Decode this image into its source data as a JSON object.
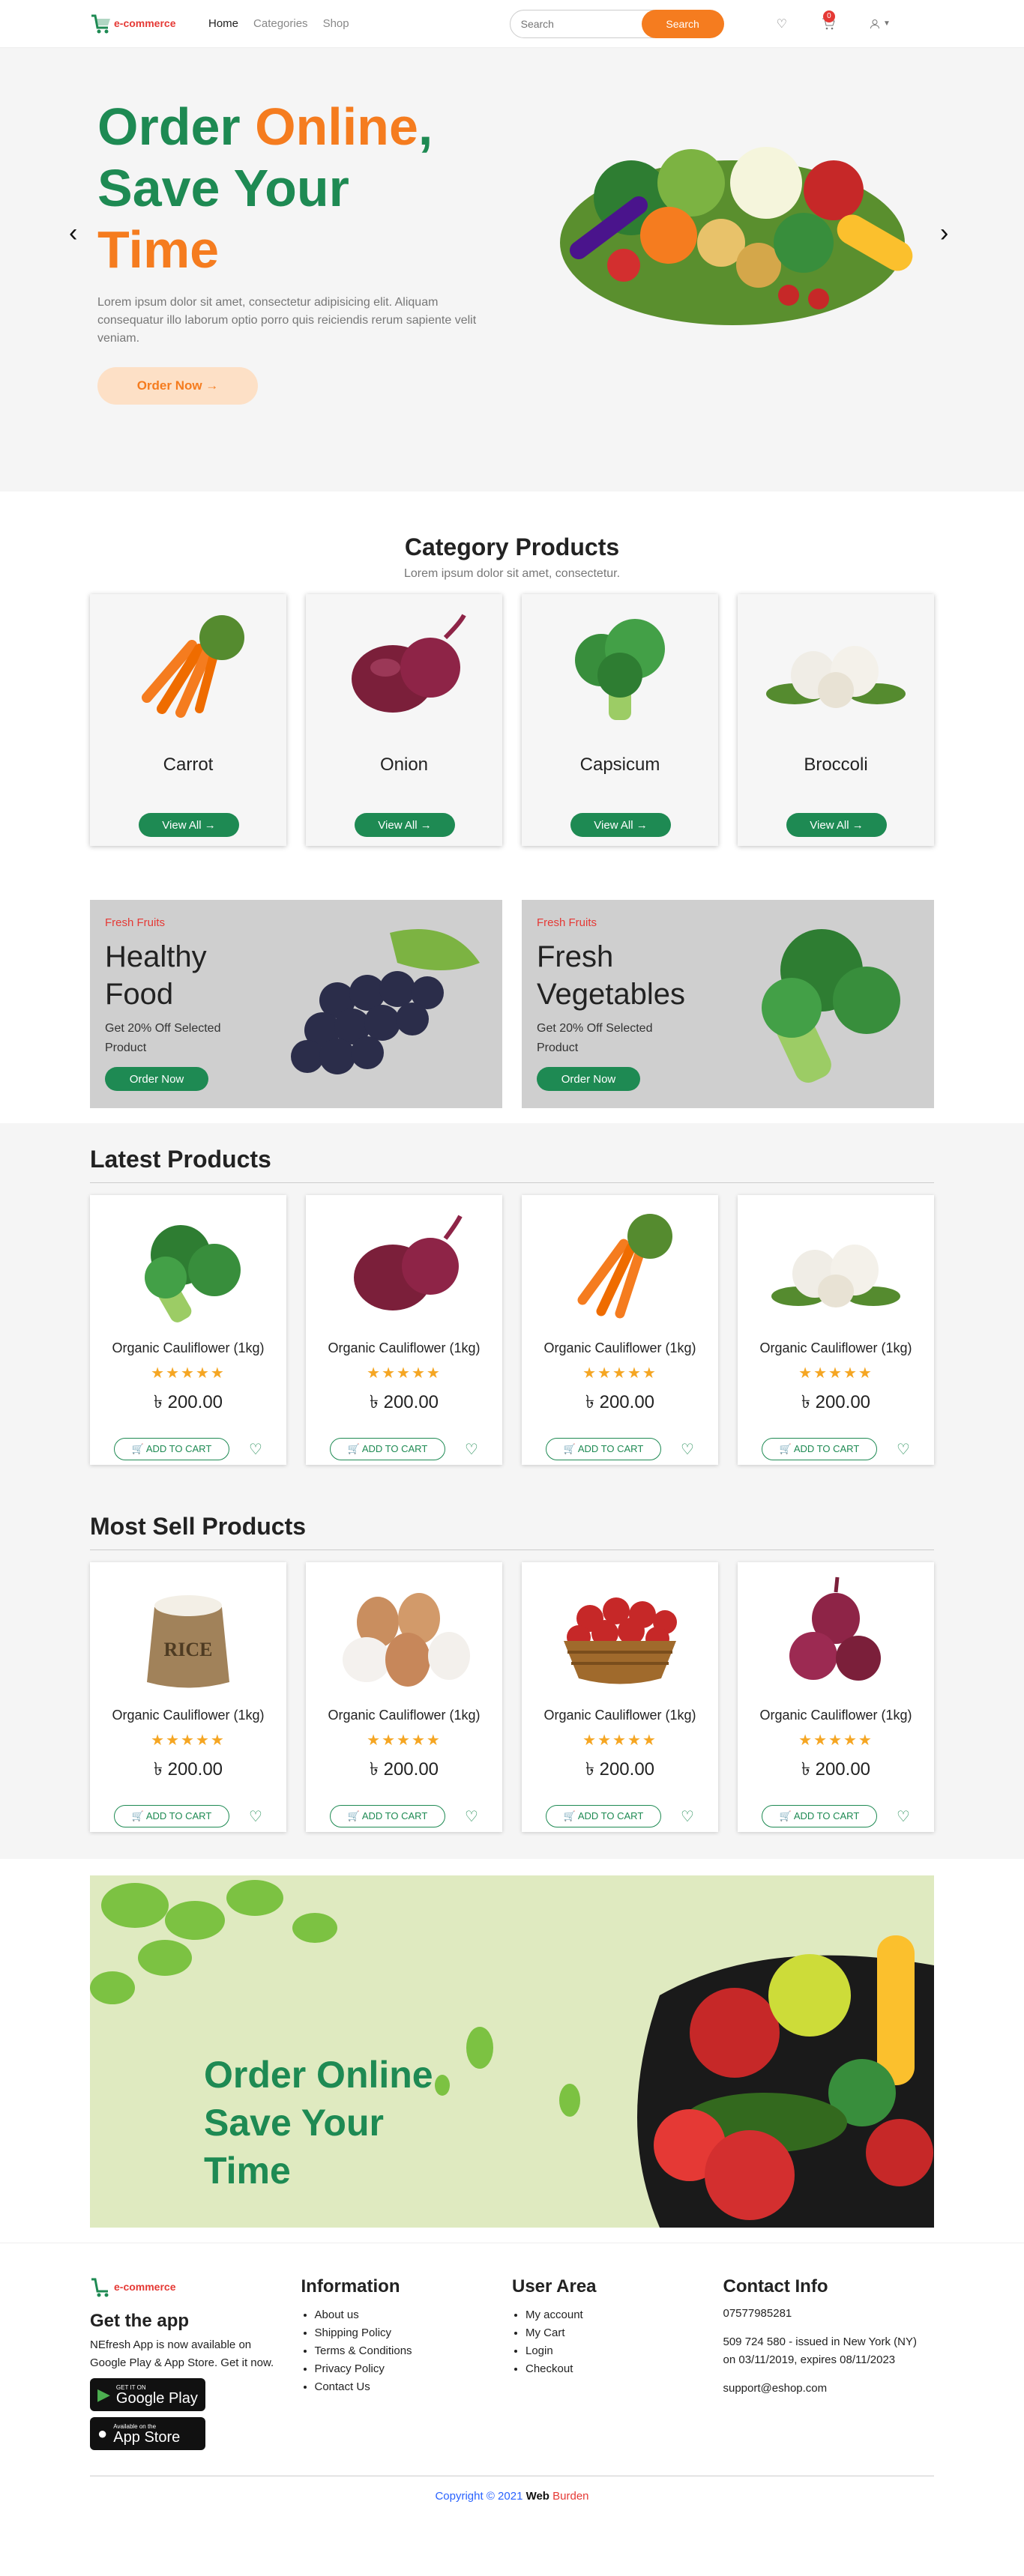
{
  "nav": {
    "brand": "e-commerce",
    "links": [
      "Home",
      "Categories",
      "Shop"
    ],
    "search_placeholder": "Search",
    "search_button": "Search",
    "cart_count": "0"
  },
  "hero": {
    "title_part1": "Order ",
    "title_part2": "Online",
    "title_part3": ",",
    "title_line2": "Save Your",
    "title_line3": "Time",
    "description": "Lorem ipsum dolor sit amet, consectetur adipisicing elit. Aliquam consequatur illo laborum optio porro quis reiciendis rerum sapiente velit veniam.",
    "button": "Order Now →"
  },
  "category": {
    "title": "Category Products",
    "subtitle": "Lorem ipsum dolor sit amet, consectetur.",
    "items": [
      {
        "name": "Carrot",
        "button": "View All →"
      },
      {
        "name": "Onion",
        "button": "View All →"
      },
      {
        "name": "Capsicum",
        "button": "View All →"
      },
      {
        "name": "Broccoli",
        "button": "View All →"
      }
    ]
  },
  "banners": [
    {
      "tag": "Fresh Fruits",
      "title_line1": "Healthy",
      "title_line2": "Food",
      "desc_line1": "Get 20% Off Selected",
      "desc_line2": "Product",
      "button": "Order Now"
    },
    {
      "tag": "Fresh Fruits",
      "title_line1": "Fresh",
      "title_line2": "Vegetables",
      "desc_line1": "Get 20% Off Selected",
      "desc_line2": "Product",
      "button": "Order Now"
    }
  ],
  "latest": {
    "title": "Latest Products",
    "items": [
      {
        "name": "Organic Cauliflower (1kg)",
        "price": "৳ 200.00",
        "stars": "★★★★★",
        "button": "ADD TO CART"
      },
      {
        "name": "Organic Cauliflower (1kg)",
        "price": "৳ 200.00",
        "stars": "★★★★★",
        "button": "ADD TO CART"
      },
      {
        "name": "Organic Cauliflower (1kg)",
        "price": "৳ 200.00",
        "stars": "★★★★★",
        "button": "ADD TO CART"
      },
      {
        "name": "Organic Cauliflower (1kg)",
        "price": "৳ 200.00",
        "stars": "★★★★★",
        "button": "ADD TO CART"
      }
    ]
  },
  "mostsell": {
    "title": "Most Sell Products",
    "rice_label": "RICE",
    "items": [
      {
        "name": "Organic Cauliflower (1kg)",
        "price": "৳ 200.00",
        "stars": "★★★★★",
        "button": "ADD TO CART"
      },
      {
        "name": "Organic Cauliflower (1kg)",
        "price": "৳ 200.00",
        "stars": "★★★★★",
        "button": "ADD TO CART"
      },
      {
        "name": "Organic Cauliflower (1kg)",
        "price": "৳ 200.00",
        "stars": "★★★★★",
        "button": "ADD TO CART"
      },
      {
        "name": "Organic Cauliflower (1kg)",
        "price": "৳ 200.00",
        "stars": "★★★★★",
        "button": "ADD TO CART"
      }
    ]
  },
  "promo": {
    "line1": "Order Online",
    "line2": "Save Your",
    "line3": "Time"
  },
  "footer": {
    "brand": "e-commerce",
    "app_title": "Get the app",
    "app_desc": "NEfresh App is now available on Google Play & App Store. Get it now.",
    "google_small": "GET IT ON",
    "google_big": "Google Play",
    "apple_small": "Available on the",
    "apple_big": "App Store",
    "info_title": "Information",
    "info_links": [
      "About us",
      "Shipping Policy",
      "Terms & Conditions",
      "Privacy Policy",
      "Contact Us"
    ],
    "user_title": "User Area",
    "user_links": [
      "My account",
      "My Cart",
      "Login",
      "Checkout"
    ],
    "contact_title": "Contact Info",
    "phone": "07577985281",
    "address": "509 724 580 - issued in New York (NY) on 03/11/2019, expires 08/11/2023",
    "email": "support@eshop.com",
    "copyright": "Copyright © 2021 ",
    "web": "Web",
    "burden": " Burden"
  },
  "colors": {
    "green": "#1e8a53",
    "orange": "#f57c1f",
    "red": "#e53935"
  }
}
